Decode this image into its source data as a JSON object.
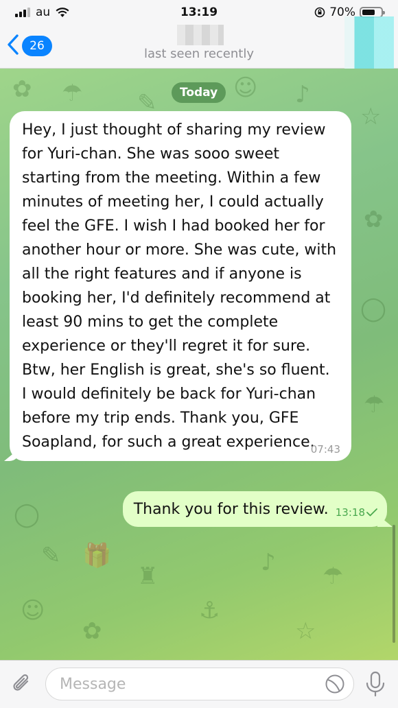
{
  "status_bar": {
    "carrier": "au",
    "time": "13:19",
    "battery": "70%",
    "battery_level": 0.7
  },
  "header": {
    "back_count": "26",
    "subtitle": "last seen recently"
  },
  "chat": {
    "date_chip": "Today",
    "messages": [
      {
        "direction": "incoming",
        "text": "Hey, I just thought of sharing my review for Yuri-chan. She was sooo sweet starting from the meeting. Within a few minutes of meeting her, I could actually feel the GFE. I wish I had booked her for another hour or more. She was cute, with all the right features and if anyone is booking her, I'd definitely recommend at least 90 mins to get the complete experience or they'll regret it for sure. Btw, her English is great, she's so fluent. I would definitely be back for Yuri-chan before my trip ends. Thank you, GFE Soapland, for such a great experience.",
        "time": "07:43"
      },
      {
        "direction": "outgoing",
        "text": "Thank you for this review.",
        "time": "13:18"
      }
    ]
  },
  "input": {
    "placeholder": "Message"
  },
  "colors": {
    "accent": "#0a84ff",
    "outgoing_bubble": "#e2ffc7",
    "read_check": "#4aa84e"
  }
}
